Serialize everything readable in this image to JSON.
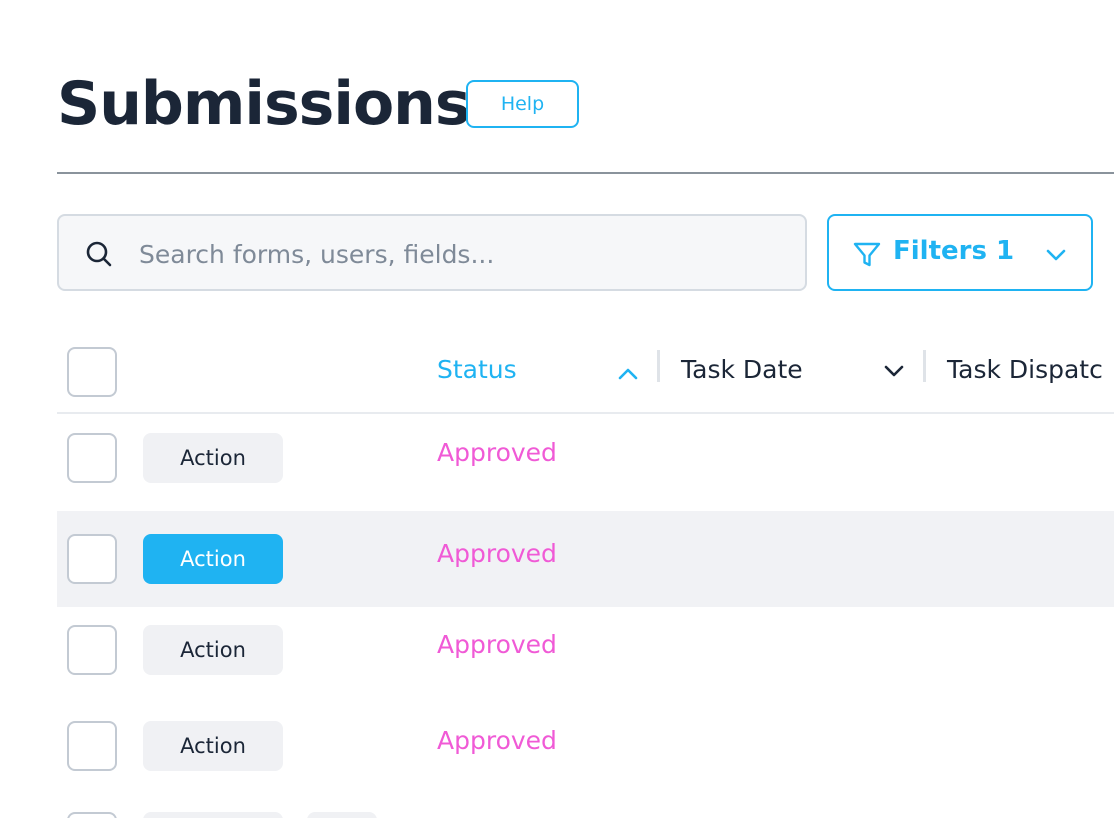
{
  "page": {
    "title": "Submissions",
    "help_label": "Help"
  },
  "search": {
    "placeholder": "Search forms, users, fields...",
    "value": "",
    "icon": "search-icon"
  },
  "filters": {
    "label": "Filters 1",
    "icon": "filter-icon",
    "chevron": "chevron-down-icon"
  },
  "colors": {
    "accent": "#1fb3f2",
    "status_approved": "#f05ad6",
    "text_dark": "#1b2637",
    "row_hover": "#f1f2f5"
  },
  "table": {
    "columns": [
      {
        "label": "Status",
        "sort": "ascending",
        "active": true
      },
      {
        "label": "Task Date",
        "sort": "descending",
        "active": false
      },
      {
        "label": "Task Dispatc",
        "sort": "none",
        "active": false
      }
    ],
    "rows": [
      {
        "action_label": "Action",
        "status": "Approved",
        "highlighted": false,
        "checked": false
      },
      {
        "action_label": "Action",
        "status": "Approved",
        "highlighted": true,
        "checked": false
      },
      {
        "action_label": "Action",
        "status": "Approved",
        "highlighted": false,
        "checked": false
      },
      {
        "action_label": "Action",
        "status": "Approved",
        "highlighted": false,
        "checked": false
      }
    ]
  }
}
